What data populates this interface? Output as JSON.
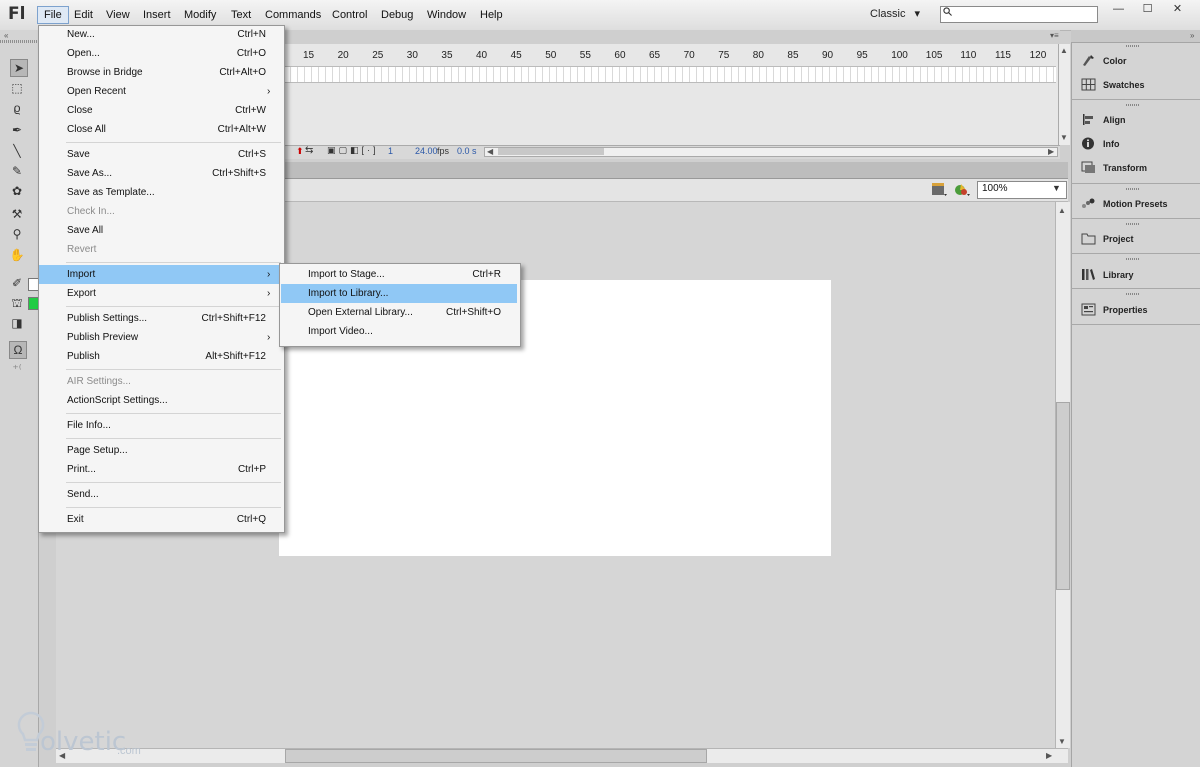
{
  "app": {
    "logo": "Fl",
    "menubar": [
      "File",
      "Edit",
      "View",
      "Insert",
      "Modify",
      "Text",
      "Commands",
      "Control",
      "Debug",
      "Window",
      "Help"
    ],
    "active_menu": "File",
    "workspace": "Classic",
    "workspace_arrow": "▾"
  },
  "window_controls": {
    "minimize": "—",
    "maximize": "☐",
    "close": "✕"
  },
  "timeline": {
    "frame_numbers": [
      "15",
      "20",
      "25",
      "30",
      "35",
      "40",
      "45",
      "50",
      "55",
      "60",
      "65",
      "70",
      "75",
      "80",
      "85",
      "90",
      "95",
      "100",
      "105",
      "110",
      "115",
      "120"
    ],
    "current_frame": "1",
    "fps": "24.00",
    "fps_unit": "fps",
    "time": "0.0 s"
  },
  "stage": {
    "zoom": "100%"
  },
  "right_panel": {
    "items": [
      "Color",
      "Swatches",
      "Align",
      "Info",
      "Transform",
      "Motion Presets",
      "Project",
      "Library",
      "Properties"
    ]
  },
  "file_menu": {
    "items": [
      {
        "label": "New...",
        "shortcut": "Ctrl+N"
      },
      {
        "label": "Open...",
        "shortcut": "Ctrl+O"
      },
      {
        "label": "Browse in Bridge",
        "shortcut": "Ctrl+Alt+O"
      },
      {
        "label": "Open Recent",
        "shortcut": "",
        "submenu": true
      },
      {
        "label": "Close",
        "shortcut": "Ctrl+W"
      },
      {
        "label": "Close All",
        "shortcut": "Ctrl+Alt+W"
      },
      {
        "label": "Save",
        "shortcut": "Ctrl+S"
      },
      {
        "label": "Save As...",
        "shortcut": "Ctrl+Shift+S"
      },
      {
        "label": "Save as Template...",
        "shortcut": ""
      },
      {
        "label": "Check In...",
        "shortcut": "",
        "disabled": true
      },
      {
        "label": "Save All",
        "shortcut": ""
      },
      {
        "label": "Revert",
        "shortcut": "",
        "disabled": true
      },
      {
        "label": "Import",
        "shortcut": "",
        "submenu": true,
        "highlighted": true
      },
      {
        "label": "Export",
        "shortcut": "",
        "submenu": true
      },
      {
        "label": "Publish Settings...",
        "shortcut": "Ctrl+Shift+F12"
      },
      {
        "label": "Publish Preview",
        "shortcut": "",
        "submenu": true
      },
      {
        "label": "Publish",
        "shortcut": "Alt+Shift+F12"
      },
      {
        "label": "AIR Settings...",
        "shortcut": "",
        "disabled": true
      },
      {
        "label": "ActionScript Settings...",
        "shortcut": ""
      },
      {
        "label": "File Info...",
        "shortcut": ""
      },
      {
        "label": "Page Setup...",
        "shortcut": ""
      },
      {
        "label": "Print...",
        "shortcut": "Ctrl+P"
      },
      {
        "label": "Send...",
        "shortcut": ""
      },
      {
        "label": "Exit",
        "shortcut": "Ctrl+Q"
      }
    ]
  },
  "import_submenu": {
    "items": [
      {
        "label": "Import to Stage...",
        "shortcut": "Ctrl+R"
      },
      {
        "label": "Import to Library...",
        "shortcut": "",
        "highlighted": true
      },
      {
        "label": "Open External Library...",
        "shortcut": "Ctrl+Shift+O"
      },
      {
        "label": "Import Video...",
        "shortcut": ""
      }
    ]
  },
  "submenu_arrow": "›",
  "watermark": {
    "text": "olvetic",
    "suffix": ".com"
  },
  "colors": {
    "highlight": "#90c8f5",
    "stage": "#ffffff",
    "pasteboard": "#d6d6d6"
  }
}
